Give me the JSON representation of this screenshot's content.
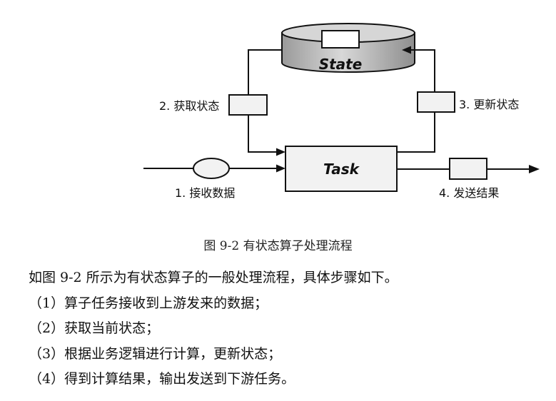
{
  "diagram": {
    "state_label": "State",
    "task_label": "Task",
    "step1": "1. 接收数据",
    "step2": "2. 获取状态",
    "step3": "3. 更新状态",
    "step4": "4. 发送结果"
  },
  "caption": "图 9-2  有状态算子处理流程",
  "paragraph": {
    "intro": "如图 9-2 所示为有状态算子的一般处理流程，具体步骤如下。",
    "items": [
      "（1）算子任务接收到上游发来的数据；",
      "（2）获取当前状态；",
      "（3）根据业务逻辑进行计算，更新状态；",
      "（4）得到计算结果，输出发送到下游任务。"
    ]
  }
}
